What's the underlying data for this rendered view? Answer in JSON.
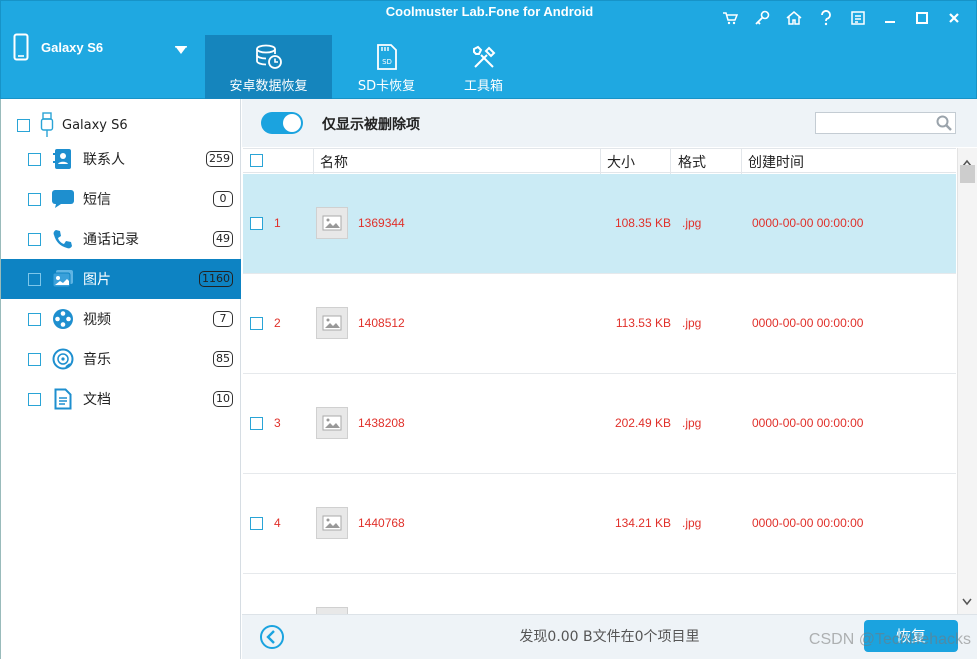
{
  "app": {
    "title": "Coolmuster Lab.Fone for Android"
  },
  "device": {
    "name": "Galaxy S6"
  },
  "main_tabs": [
    {
      "label": "安卓数据恢复",
      "active": true,
      "icon": "database-clock-icon"
    },
    {
      "label": "SD卡恢复",
      "active": false,
      "icon": "sd-card-icon"
    },
    {
      "label": "工具箱",
      "active": false,
      "icon": "tools-icon"
    }
  ],
  "sidebar": {
    "root": "Galaxy S6",
    "items": [
      {
        "label": "联系人",
        "count": "259",
        "icon": "contacts-icon"
      },
      {
        "label": "短信",
        "count": "0",
        "icon": "message-icon"
      },
      {
        "label": "通话记录",
        "count": "49",
        "icon": "phone-icon"
      },
      {
        "label": "图片",
        "count": "1160",
        "icon": "photo-icon",
        "active": true
      },
      {
        "label": "视频",
        "count": "7",
        "icon": "film-reel-icon"
      },
      {
        "label": "音乐",
        "count": "85",
        "icon": "music-disc-icon"
      },
      {
        "label": "文档",
        "count": "10",
        "icon": "document-icon"
      }
    ]
  },
  "toolbar": {
    "toggle_label": "仅显示被删除项",
    "toggle_on": true,
    "search_placeholder": ""
  },
  "table": {
    "headers": {
      "name": "名称",
      "size": "大小",
      "format": "格式",
      "created": "创建时间"
    },
    "rows": [
      {
        "index": "1",
        "name": "1369344",
        "size": "108.35 KB",
        "format": ".jpg",
        "created": "0000-00-00 00:00:00",
        "selected": true
      },
      {
        "index": "2",
        "name": "1408512",
        "size": "113.53 KB",
        "format": ".jpg",
        "created": "0000-00-00 00:00:00"
      },
      {
        "index": "3",
        "name": "1438208",
        "size": "202.49 KB",
        "format": ".jpg",
        "created": "0000-00-00 00:00:00"
      },
      {
        "index": "4",
        "name": "1440768",
        "size": "134.21 KB",
        "format": ".jpg",
        "created": "0000-00-00 00:00:00"
      }
    ]
  },
  "footer": {
    "status": "发现0.00 B文件在0个项目里",
    "recover_label": "恢复"
  },
  "watermark": "CSDN @Techlifehacks",
  "colors": {
    "header": "#1fa8e1",
    "active_tab": "#1585bd",
    "sidebar_active": "#0d83c3",
    "row_selected": "#cbebf5",
    "row_text": "#e0302a"
  }
}
